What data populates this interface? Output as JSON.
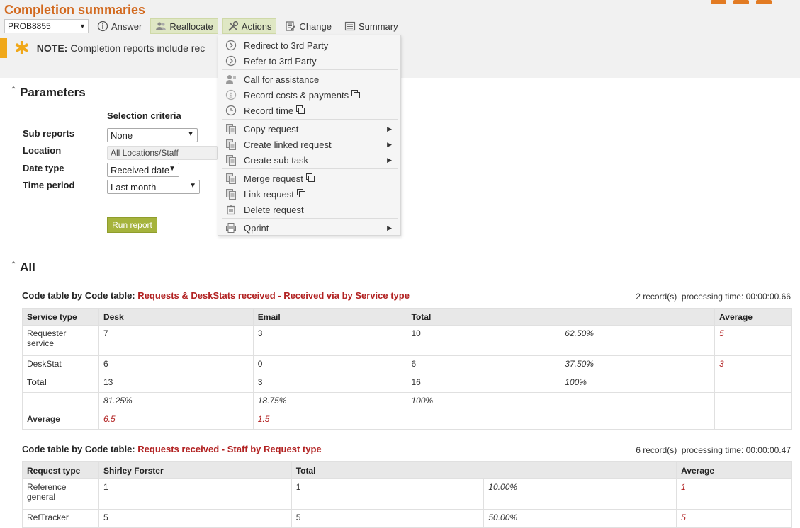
{
  "page": {
    "title": "Completion summaries"
  },
  "toolbar": {
    "request_id": "PROB8855",
    "answer": "Answer",
    "reallocate": "Reallocate",
    "actions": "Actions",
    "change": "Change",
    "summary": "Summary"
  },
  "note": {
    "label": "NOTE:",
    "text": "Completion reports include rec"
  },
  "parameters": {
    "heading": "Parameters",
    "criteria_heading": "Selection criteria",
    "sub_reports": {
      "label": "Sub reports",
      "value": "None"
    },
    "location": {
      "label": "Location",
      "value": "All Locations/Staff"
    },
    "date_type": {
      "label": "Date type",
      "value": "Received date"
    },
    "time_period": {
      "label": "Time period",
      "value": "Last month"
    },
    "run_button": "Run report"
  },
  "actions_menu": {
    "items": [
      {
        "label": "Redirect to 3rd Party",
        "icon": "chevron-circle-icon"
      },
      {
        "label": "Refer to 3rd Party",
        "icon": "chevron-circle-icon"
      },
      {
        "label": "Call for assistance",
        "icon": "user-call-icon"
      },
      {
        "label": "Record costs & payments",
        "icon": "dollar-icon"
      },
      {
        "label": "Record time",
        "icon": "clock-icon"
      },
      {
        "label": "Copy request",
        "icon": "copy-icon"
      },
      {
        "label": "Create linked request",
        "icon": "copy-icon"
      },
      {
        "label": "Create sub task",
        "icon": "copy-icon"
      },
      {
        "label": "Merge request",
        "icon": "copy-icon"
      },
      {
        "label": "Link request",
        "icon": "copy-icon"
      },
      {
        "label": "Delete request",
        "icon": "trash-icon"
      },
      {
        "label": "Qprint",
        "icon": "printer-icon"
      }
    ]
  },
  "all_section": {
    "heading": "All"
  },
  "table1": {
    "caption_prefix": "Code table by Code table:",
    "caption_detail": "Requests & DeskStats received - Received via by Service type",
    "records": "2 record(s)",
    "processing": "processing time: 00:00:00.66",
    "headers": [
      "Service type",
      "Desk",
      "Email",
      "Total",
      "Average"
    ],
    "rows": [
      {
        "label": "Requester service",
        "desk": "7",
        "email": "3",
        "total": "10",
        "pct": "62.50%",
        "avg": "5"
      },
      {
        "label": "DeskStat",
        "desk": "6",
        "email": "0",
        "total": "6",
        "pct": "37.50%",
        "avg": "3"
      },
      {
        "label": "Total",
        "desk": "13",
        "email": "3",
        "total": "16",
        "pct": "100%",
        "avg": ""
      },
      {
        "label": "",
        "desk": "81.25%",
        "email": "18.75%",
        "total": "100%",
        "pct": "",
        "avg": ""
      },
      {
        "label": "Average",
        "desk": "6.5",
        "email": "1.5",
        "total": "",
        "pct": "",
        "avg": ""
      }
    ]
  },
  "table2": {
    "caption_prefix": "Code table by Code table:",
    "caption_detail": "Requests received - Staff by Request type",
    "records": "6 record(s)",
    "processing": "processing time: 00:00:00.47",
    "headers": [
      "Request type",
      "Shirley Forster",
      "Total",
      "Average"
    ],
    "rows": [
      {
        "label": "Reference general",
        "staff": "1",
        "total": "1",
        "pct": "10.00%",
        "avg": "1"
      },
      {
        "label": "RefTracker",
        "staff": "5",
        "total": "5",
        "pct": "50.00%",
        "avg": "5"
      }
    ]
  },
  "colors": {
    "accent": "#d2691e",
    "highlight": "#b22222",
    "note": "#f0a81a",
    "run": "#a5b33c"
  }
}
